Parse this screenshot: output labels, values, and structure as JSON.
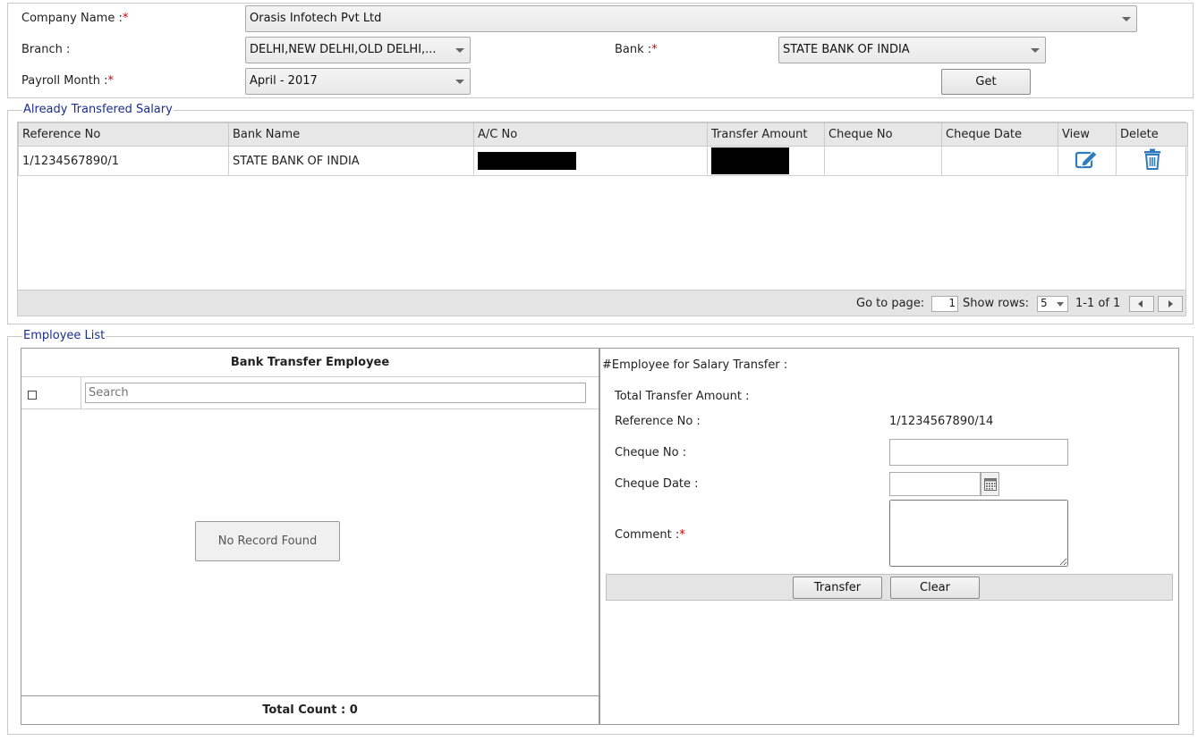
{
  "filters": {
    "company_label": "Company Name :",
    "company_value": "Orasis Infotech Pvt Ltd",
    "branch_label": "Branch :",
    "branch_value": "DELHI,NEW DELHI,OLD DELHI,...",
    "bank_label": "Bank :",
    "bank_value": "STATE BANK OF INDIA",
    "payroll_label": "Payroll Month :",
    "payroll_value": "April - 2017",
    "required_mark": "*",
    "get_button": "Get"
  },
  "transfered": {
    "legend": "Already Transfered Salary",
    "columns": [
      "Reference No",
      "Bank Name",
      "A/C No",
      "Transfer Amount",
      "Cheque No",
      "Cheque Date",
      "View",
      "Delete"
    ],
    "rows": [
      {
        "reference_no": "1/1234567890/1",
        "bank_name": "STATE BANK OF INDIA",
        "ac_no": "",
        "transfer_amount": "",
        "cheque_no": "",
        "cheque_date": ""
      }
    ],
    "pager": {
      "goto_label": "Go to page:",
      "page_value": "1",
      "show_rows_label": "Show rows:",
      "rows_value": "5",
      "range": "1-1 of 1"
    }
  },
  "employee_list": {
    "legend": "Employee List",
    "left": {
      "title": "Bank Transfer Employee",
      "search_placeholder": "Search",
      "no_record": "No Record Found",
      "total_count": "Total Count : 0"
    },
    "right": {
      "title": "#Employee for Salary Transfer :",
      "total_transfer_label": "Total Transfer Amount :",
      "total_transfer_value": "",
      "reference_label": "Reference No :",
      "reference_value": "1/1234567890/14",
      "cheque_no_label": "Cheque No :",
      "cheque_date_label": "Cheque Date :",
      "comment_label": "Comment :",
      "required_mark": "*",
      "transfer_button": "Transfer",
      "clear_button": "Clear"
    }
  },
  "colors": {
    "legend": "#1a2d8f",
    "required": "#dd0000",
    "action_icon": "#2e7bbf"
  },
  "icons": [
    "dropdown-caret-icon",
    "edit-icon",
    "trash-icon",
    "calendar-icon",
    "prev-page-icon",
    "next-page-icon"
  ]
}
